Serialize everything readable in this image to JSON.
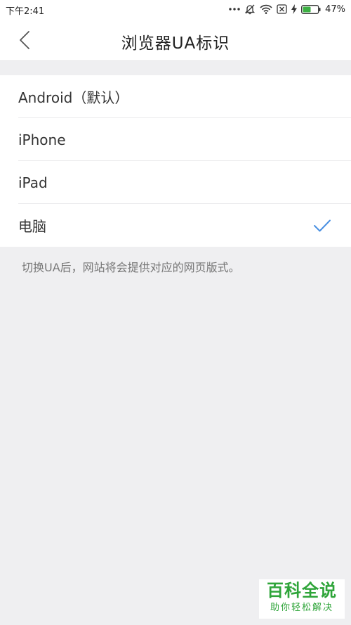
{
  "status_bar": {
    "time": "下午2:41",
    "battery_percent": "47%",
    "icons": [
      "more-dots-icon",
      "bell-off-icon",
      "wifi-icon",
      "sim-blocked-icon",
      "charging-bolt-icon",
      "battery-icon"
    ],
    "battery_level": 0.47
  },
  "header": {
    "title": "浏览器UA标识",
    "back_icon": "chevron-left-icon"
  },
  "options": [
    {
      "label": "Android（默认）",
      "selected": false
    },
    {
      "label": "iPhone",
      "selected": false
    },
    {
      "label": "iPad",
      "selected": false
    },
    {
      "label": "电脑",
      "selected": true
    }
  ],
  "hint": "切换UA后，网站将会提供对应的网页版式。",
  "watermark": {
    "main": "百科全说",
    "sub": "助你轻松解决"
  },
  "colors": {
    "accent": "#4a90e2",
    "watermark": "#2fa53a",
    "background": "#efeff1"
  }
}
